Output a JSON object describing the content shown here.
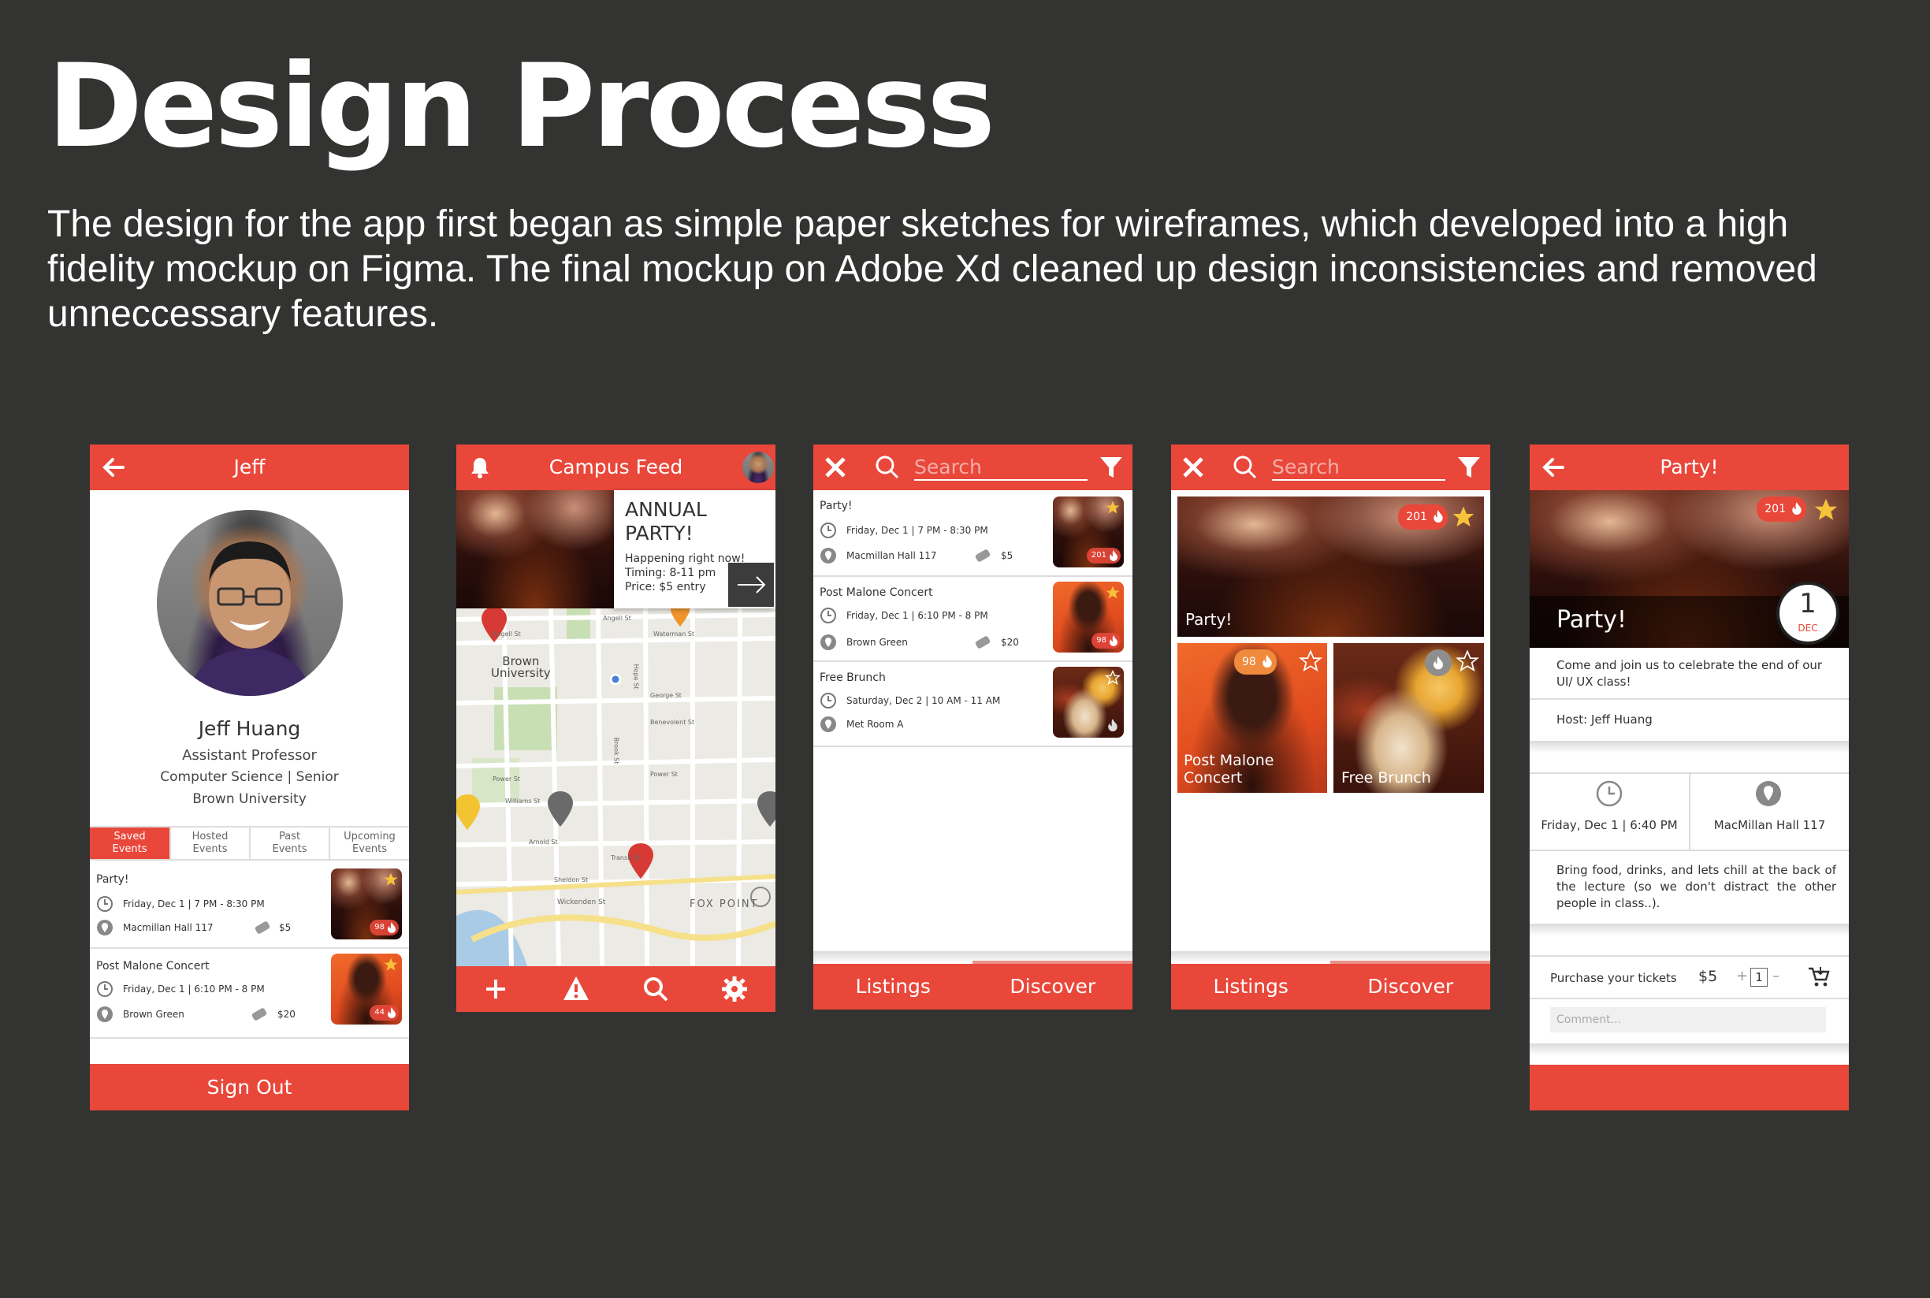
{
  "page": {
    "heading": "Design Process",
    "intro": "The design for the app first began as simple paper sketches for wireframes, which developed into a high fidelity mockup on Figma. The final mockup on Adobe Xd cleaned up design inconsistencies and removed unneccessary features."
  },
  "colors": {
    "accent": "#e8473a",
    "background": "#333331",
    "star": "#f5c23a"
  },
  "profile": {
    "header_title": "Jeff",
    "name": "Jeff Huang",
    "role": "Assistant Professor",
    "dept": "Computer Science | Senior",
    "school": "Brown University",
    "tabs": [
      {
        "line1": "Saved",
        "line2": "Events",
        "active": true
      },
      {
        "line1": "Hosted",
        "line2": "Events",
        "active": false
      },
      {
        "line1": "Past",
        "line2": "Events",
        "active": false
      },
      {
        "line1": "Upcoming",
        "line2": "Events",
        "active": false
      }
    ],
    "events": [
      {
        "title": "Party!",
        "time": "Friday, Dec 1  |  7 PM - 8:30 PM",
        "location": "Macmillan Hall 117",
        "price": "$5",
        "score": "98"
      },
      {
        "title": "Post Malone Concert",
        "time": "Friday, Dec 1  |  6:10 PM - 8 PM",
        "location": "Brown Green",
        "price": "$20",
        "score": "44"
      }
    ],
    "sign_out": "Sign Out"
  },
  "feed": {
    "header_title": "Campus Feed",
    "card_title_1": "ANNUAL",
    "card_title_2": "PARTY!",
    "card_line_1": "Happening right now!",
    "card_line_2": "Timing: 8-11 pm",
    "card_line_3": "Price: $5 entry",
    "map_labels": {
      "brown_1": "Brown",
      "brown_2": "University",
      "fox_point": "FOX POINT",
      "angell_1": "Angell St",
      "angell_2": "Angell St",
      "waterman": "Waterman St",
      "george": "George St",
      "benevolent": "Benevolent St",
      "power_1": "Power St",
      "power_2": "Power St",
      "williams": "Williams St",
      "arnold": "Arnold St",
      "transit": "Transit St",
      "sheldon": "Sheldon St",
      "wickenden": "Wickenden St",
      "brook": "Brook St",
      "hope": "Hope St"
    }
  },
  "listings": {
    "search_placeholder": "Search",
    "items": [
      {
        "title": "Party!",
        "time": "Friday, Dec 1  |  7 PM - 8:30 PM",
        "location": "Macmillan Hall 117",
        "price": "$5",
        "score": "201"
      },
      {
        "title": "Post Malone Concert",
        "time": "Friday, Dec 1  |  6:10 PM - 8 PM",
        "location": "Brown Green",
        "price": "$20",
        "score": "98"
      },
      {
        "title": "Free Brunch",
        "time": "Saturday, Dec 2  |  10 AM - 11 AM",
        "location": "Met Room A",
        "price": "",
        "score": ""
      }
    ],
    "tab_listings": "Listings",
    "tab_discover": "Discover"
  },
  "discover": {
    "search_placeholder": "Search",
    "hero": {
      "title": "Party!",
      "score": "201"
    },
    "tiles": [
      {
        "title_1": "Post Malone",
        "title_2": "Concert",
        "score": "98"
      },
      {
        "title_1": "Free Brunch",
        "title_2": "",
        "score": ""
      }
    ],
    "tab_listings": "Listings",
    "tab_discover": "Discover"
  },
  "detail": {
    "header_title": "Party!",
    "hero_title": "Party!",
    "score": "201",
    "date_day": "1",
    "date_month": "DEC",
    "description": "Come and join us to celebrate the end of our UI/ UX class!",
    "host": "Host: Jeff Huang",
    "time": "Friday, Dec 1  |  6:40 PM",
    "location": "MacMillan Hall 117",
    "notes": "Bring food, drinks, and lets chill at the back of the lecture (so we don't distract the other people in class..).",
    "purchase_label": "Purchase your tickets",
    "price": "$5",
    "plus": "+",
    "quantity": "1",
    "minus": "–",
    "comment_placeholder": "Comment..."
  }
}
